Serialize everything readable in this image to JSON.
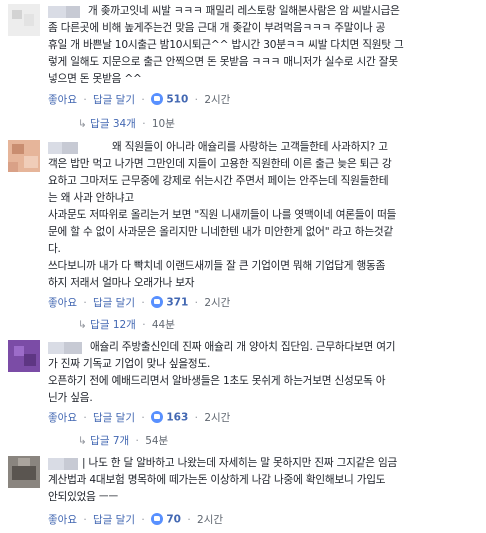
{
  "comments": [
    {
      "lines": [
        "개 좆까고잇네 씨발 ㅋㅋㅋ 패밀리 레스토랑 일해본사람은 암 씨발시급은",
        "좀 다른곳에 비해 높게주는건 맞음 근대 개 좆같이 부려먹음ㅋㅋㅋ 주말이나 공",
        "휴일 개 바쁜날 10시출근 밤10시퇴근^^ 밥시간 30분ㅋㅋ 씨발 다치면 직원탓 그",
        "렇게 일해도 지문으로 출근 안찍으면 돈 못받음 ㅋㅋㅋ 매니저가 실수로 시간 잘못",
        "넣으면 돈 못받음 ^^"
      ],
      "like": "좋아요",
      "reply": "답글 달기",
      "count": "510",
      "time": "2시간",
      "reply_summary": {
        "label": "답글 34개",
        "time": "10분"
      }
    },
    {
      "lines": [
        "왜 직원들이 아니라 애슐리를 사랑하는 고객들한테 사과하지? 고",
        "객은 밥만 먹고 나가면 그만인데 지들이 고용한 직원한테 이른 출근 늦은 퇴근 강",
        "요하고 그마저도 근무중에 강제로 쉬는시간 주면서 페이는 안주는데 직원들한테",
        "는 왜 사과 안하냐고",
        "사과문도 저따위로 올리는거 보면 \"직원 니새끼들이 나를 엿맥이네 여론들이 떠들",
        "문에 할 수 없이 사과문은 올리지만 니네한텐 내가 미안한게 없어\" 라고 하는것같",
        "다.",
        "쓰다보니까 내가 다 빡치네 이랜드새끼들 잘 큰 기업이면 뭐해 기업답게 행동좀",
        "하지 저래서 얼마나 오래가나 보자"
      ],
      "like": "좋아요",
      "reply": "답글 달기",
      "count": "371",
      "time": "2시간",
      "reply_summary": {
        "label": "답글 12개",
        "time": "44분"
      }
    },
    {
      "lines": [
        "애슐리 주방출신인데 진짜 애슐리 개 양아치 집단임. 근무하다보면 여기",
        "가 진짜 기독교 기업이 맞나 싶을정도.",
        "오픈하기 전에 예배드리면서 알바생들은 1초도 못쉬게 하는거보면 신성모독 아",
        "닌가 싶음."
      ],
      "like": "좋아요",
      "reply": "답글 달기",
      "count": "163",
      "time": "2시간",
      "reply_summary": {
        "label": "답글 7개",
        "time": "54분"
      }
    },
    {
      "lines": [
        "| 나도 한 달 알바하고 나왔는데 자세히는 말 못하지만 진짜 그지같은 임금",
        "계산법과 4대보험 명목하에 떼가는돈 이상하게 나감 나중에 확인해보니 가입도",
        "안되있었음 ㅡㅡ"
      ],
      "like": "좋아요",
      "reply": "답글 달기",
      "count": "70",
      "time": "2시간"
    }
  ],
  "ui": {
    "sep": "·",
    "reply_arrow": "↳",
    "colors": {
      "link": "#4267b2",
      "meta": "#606770",
      "like_badge": "#5890ff"
    }
  }
}
